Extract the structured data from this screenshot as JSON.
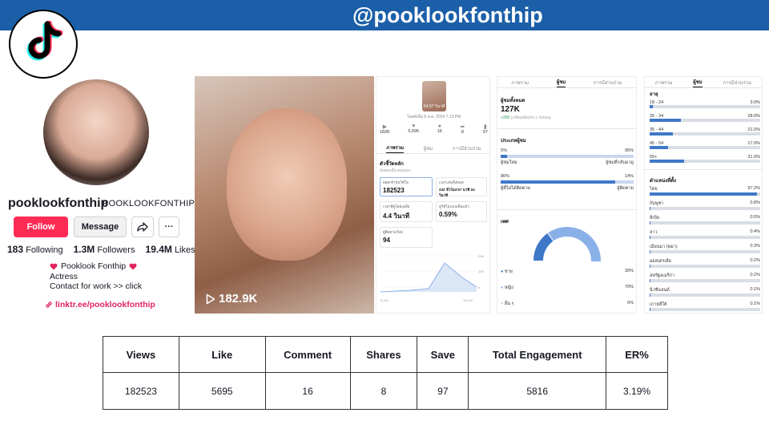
{
  "header": {
    "handle": "@pooklookfonthip"
  },
  "profile": {
    "username": "pooklookfonthip",
    "display_name": "POOKLOOKFONTHIP",
    "follow_label": "Follow",
    "message_label": "Message",
    "more_label": "···",
    "following_count": "183",
    "following_label": "Following",
    "followers_count": "1.3M",
    "followers_label": "Followers",
    "likes_count": "19.4M",
    "likes_label": "Likes",
    "bio_name": "Pooklook Fonthip",
    "bio_role": "Actress",
    "bio_contact": "Contact for work >> click",
    "link": "linktr.ee/pooklookfonthip"
  },
  "video": {
    "views": "182.9K"
  },
  "analytics_video": {
    "thumb_label": "54.57 วินาที",
    "posted": "โพสต์เมื่อ 8 ส.ค. 2024 7:13 PM",
    "metrics": [
      "182K",
      "5,695",
      "16",
      "8",
      "97"
    ],
    "tabs": [
      "ภาพรวม",
      "ผู้ชม",
      "การมีส่วนร่วม"
    ],
    "section_title": "ตัวชี้วัดหลัก",
    "section_sub": "อัปเดตเมื่อ 8/8/2024",
    "cards": [
      {
        "label": "ยอดเข้าชมวิดีโอ",
        "value": "182523"
      },
      {
        "label": "เวลาเล่นทั้งหมด",
        "value": "232 ชั่วโมง:57 นาที:24 วินาที"
      },
      {
        "label": "เวลาที่ดูโดยเฉลี่ย",
        "value": "4.4 วินาที"
      },
      {
        "label": "ดูวิดีโอแบบเต็มแล้ว",
        "value": "0.59%"
      },
      {
        "label": "ผู้ติดตามใหม่",
        "value": "94"
      }
    ],
    "chart_ticks": [
      "29K",
      "15K",
      "0"
    ],
    "chart_x": [
      "8 ส.ค.",
      "15 ส.ค."
    ]
  },
  "analytics_audience": {
    "tabs": [
      "ภาพรวม",
      "ผู้ชม",
      "การมีส่วนร่วม"
    ],
    "total_title": "ผู้ชมทั้งหมด",
    "total_value": "127K",
    "total_delta": "+356",
    "total_delta_note": "(เปรียบเทียบกับ 1 วันก่อน)",
    "type_title": "ประเภทผู้ชม",
    "type_rows": [
      {
        "left_pct": "5%",
        "right_pct": "95%",
        "left_label": "ผู้ชมใหม่",
        "right_label": "ผู้ชมที่กลับมาดู",
        "fill": 0.05
      },
      {
        "left_pct": "86%",
        "right_pct": "14%",
        "left_label": "ผู้ที่ไม่ได้ติดตาม",
        "right_label": "ผู้ติดตาม",
        "fill": 0.86
      }
    ],
    "gender_title": "เพศ",
    "gender_rows": [
      {
        "label": "ชาย",
        "value": "30%",
        "color": "#3f78c8"
      },
      {
        "label": "หญิง",
        "value": "70%",
        "color": "#8ab0e8"
      },
      {
        "label": "อื่น ๆ",
        "value": "0%",
        "color": "#c8ced8"
      }
    ],
    "gender_share": [
      0.3,
      0.7,
      0.0
    ]
  },
  "analytics_age": {
    "tabs": [
      "ภาพรวม",
      "ผู้ชม",
      "การมีส่วนร่วม"
    ],
    "age_title": "อายุ",
    "age_rows": [
      {
        "label": "18 - 24",
        "value": "3.0%",
        "fill": 0.03
      },
      {
        "label": "25 - 34",
        "value": "28.0%",
        "fill": 0.28
      },
      {
        "label": "35 - 44",
        "value": "21.0%",
        "fill": 0.21
      },
      {
        "label": "45 - 54",
        "value": "17.0%",
        "fill": 0.17
      },
      {
        "label": "55+",
        "value": "31.0%",
        "fill": 0.31
      }
    ],
    "loc_title": "ตำแหน่งที่ตั้ง",
    "loc_rows": [
      {
        "label": "ไทย",
        "value": "97.2%",
        "fill": 0.972
      },
      {
        "label": "กัมพูชา",
        "value": "0.8%",
        "fill": 0.008
      },
      {
        "label": "ลิเบีย",
        "value": "0.5%",
        "fill": 0.005
      },
      {
        "label": "ลาว",
        "value": "0.4%",
        "fill": 0.004
      },
      {
        "label": "เมียนมา (พม่า)",
        "value": "0.3%",
        "fill": 0.003
      },
      {
        "label": "ออสเตรเลีย",
        "value": "0.2%",
        "fill": 0.002
      },
      {
        "label": "สหรัฐอเมริกา",
        "value": "0.2%",
        "fill": 0.002
      },
      {
        "label": "นิวซีแลนด์",
        "value": "0.1%",
        "fill": 0.001
      },
      {
        "label": "เกาหลีใต้",
        "value": "0.1%",
        "fill": 0.001
      }
    ]
  },
  "table": {
    "headers": [
      "Views",
      "Like",
      "Comment",
      "Shares",
      "Save",
      "Total Engagement",
      "ER%"
    ],
    "values": [
      "182523",
      "5695",
      "16",
      "8",
      "97",
      "5816",
      "3.19%"
    ]
  },
  "colors": {
    "banner": "#1b5fa8",
    "follow": "#fe2c55",
    "bar": "#3f78c8",
    "link": "#e0245e"
  },
  "icons": [
    "tiktok-logo-icon",
    "share-icon",
    "heart-icon",
    "link-icon",
    "play-icon"
  ]
}
